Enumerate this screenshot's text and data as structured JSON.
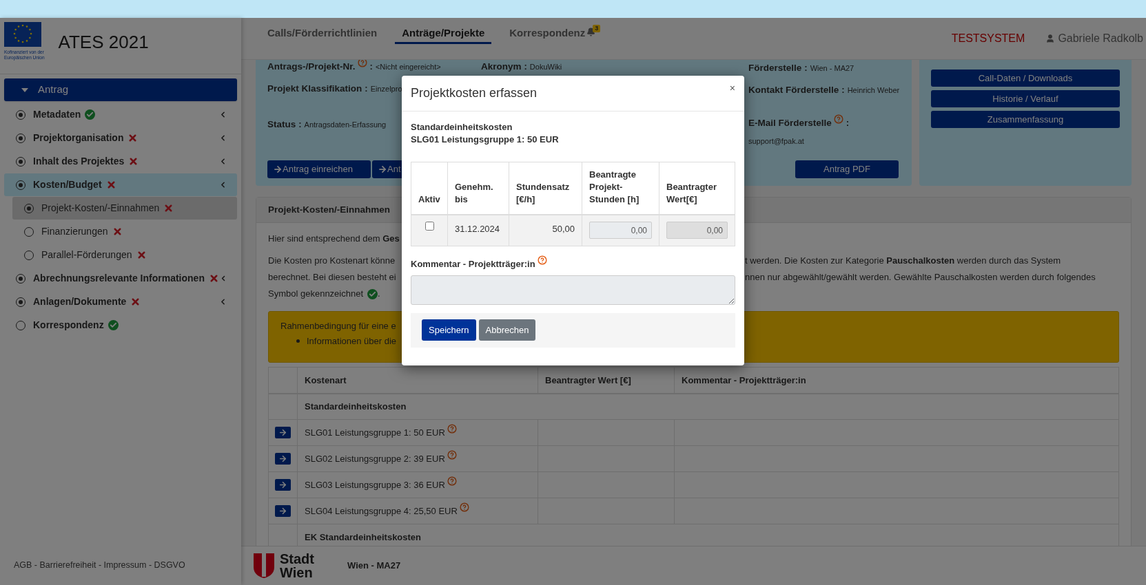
{
  "app": {
    "title": "ATES 2021",
    "eu_caption": [
      "Kofinanziert von der",
      "Europäischen Union"
    ]
  },
  "sidebar": {
    "header": "Antrag",
    "items": [
      {
        "label": "Metadaten",
        "complete": true,
        "marked": true,
        "selected": false,
        "expandable": true
      },
      {
        "label": "Projektorganisation",
        "complete": false,
        "marked": true,
        "selected": false,
        "expandable": true
      },
      {
        "label": "Inhalt des Projektes",
        "complete": false,
        "marked": true,
        "selected": false,
        "expandable": true
      },
      {
        "label": "Kosten/Budget",
        "complete": false,
        "marked": true,
        "selected": true,
        "expandable": true,
        "children": [
          {
            "label": "Projekt-Kosten/-Einnahmen",
            "complete": false,
            "marked": true,
            "selected": true,
            "expandable": false
          },
          {
            "label": "Finanzierungen",
            "complete": false,
            "marked": false,
            "selected": false,
            "expandable": false
          },
          {
            "label": "Parallel-Förderungen",
            "complete": false,
            "marked": false,
            "selected": false,
            "expandable": false
          }
        ]
      },
      {
        "label": "Abrechnungsrelevante Informationen",
        "complete": false,
        "marked": true,
        "selected": false,
        "expandable": true
      },
      {
        "label": "Anlagen/Dokumente",
        "complete": false,
        "marked": true,
        "selected": false,
        "expandable": true
      },
      {
        "label": "Korrespondenz",
        "complete": true,
        "marked": false,
        "selected": false,
        "expandable": false
      }
    ],
    "footer": "AGB - Barrierefreiheit - Impressum - DSGVO"
  },
  "top_nav": {
    "tabs": [
      {
        "label": "Calls/Förderrichtlinien",
        "selected": false
      },
      {
        "label": "Anträge/Projekte",
        "selected": true
      },
      {
        "label": "Korrespondenz",
        "selected": false,
        "badge": "3"
      }
    ],
    "system_label": "TESTSYSTEM",
    "user": "Gabriele Radkolb"
  },
  "info_card": {
    "columns": [
      [
        {
          "label": "Antrags-/Projekt-Nr.",
          "help": true,
          "colon": ":",
          "value": "<Nicht eingereicht>"
        },
        {
          "label": "Projekt Klassifikation",
          "colon": ":",
          "value": "Einzelpro"
        },
        {
          "label": "Status",
          "colon": ":",
          "value": "Antragsdaten-Erfassung"
        }
      ],
      [
        {
          "label": "Akronym",
          "colon": ":",
          "value": "DokuWiki"
        }
      ],
      [
        {
          "label": "Förderstelle",
          "colon": ":",
          "value": "Wien - MA27"
        },
        {
          "label": "Kontakt Förderstelle",
          "colon": ":",
          "value": "Heinrich Weber"
        },
        {
          "label": "E-Mail Förderstelle",
          "help": true,
          "colon": ":",
          "value": "support@fpak.at"
        }
      ]
    ],
    "buttons": [
      {
        "label": "Antrag einreichen",
        "arrow": true
      },
      {
        "label": "Ant",
        "arrow": true
      }
    ],
    "pdf_button": "Antrag PDF"
  },
  "side_card": {
    "buttons": [
      "Call-Daten / Downloads",
      "Historie / Verlauf",
      "Zusammenfassung"
    ]
  },
  "section": {
    "title": "Projekt-Kosten/-Einnahmen",
    "intro": "Hier sind entsprechend dem **Ges**",
    "lines": [
      {
        "left": "Die Kosten pro Kostenart könne",
        "right": "t werden. Die Kosten zur Kategorie **Pauschalkosten** werden durch das System"
      },
      {
        "left": "berechnet. Bei diesen besteht ei",
        "right": "nnen nur abgewählt/gewählt werden. Gewählte Pauschalkosten werden durch folgendes"
      },
      {
        "left": "Symbol gekennzeichnet",
        "left_check": true,
        "left_end": "."
      }
    ],
    "notice": {
      "title": "Rahmenbedingung für eine e",
      "bullets": [
        "Informationen über die"
      ]
    },
    "table": {
      "columns": [
        "Kostenart",
        "Beantragter Wert [€]",
        "Kommentar - Projektträger:in"
      ],
      "rows": [
        {
          "kind": "group",
          "label": "Standardeinheitskosten"
        },
        {
          "kind": "item",
          "label": "SLG01 Leistungsgruppe 1: 50 EUR",
          "help": true
        },
        {
          "kind": "item",
          "label": "SLG02 Leistungsgruppe 2: 39 EUR",
          "help": true
        },
        {
          "kind": "item",
          "label": "SLG03 Leistungsgruppe 3: 36 EUR",
          "help": true
        },
        {
          "kind": "item",
          "label": "SLG04 Leistungsgruppe 4: 25,50 EUR",
          "help": true
        },
        {
          "kind": "group",
          "label": "EK Standardeinheitskosten"
        }
      ]
    }
  },
  "footer": {
    "logo": [
      "Stadt",
      "Wien"
    ],
    "department": "Wien - MA27"
  },
  "modal": {
    "title": "Projektkosten erfassen",
    "close": "×",
    "heading": [
      "Standardeinheitskosten",
      "SLG01 Leistungsgruppe 1: 50 EUR"
    ],
    "columns": [
      "Aktiv",
      "Genehm. bis",
      "Stundensatz [€/h]",
      "Beantragte Projekt-Stunden [h]",
      "Beantragter Wert[€]"
    ],
    "row": {
      "checked": false,
      "until": "31.12.2024",
      "rate": "50,00",
      "hours": {
        "value": "0,00",
        "disabled": false
      },
      "amount": {
        "value": "0,00",
        "disabled": true
      }
    },
    "comment_label": "Kommentar - Projektträger:in",
    "comment_help": true,
    "buttons": [
      {
        "label": "Speichern",
        "kind": "primary"
      },
      {
        "label": "Abbrechen",
        "kind": "secondary"
      }
    ]
  }
}
